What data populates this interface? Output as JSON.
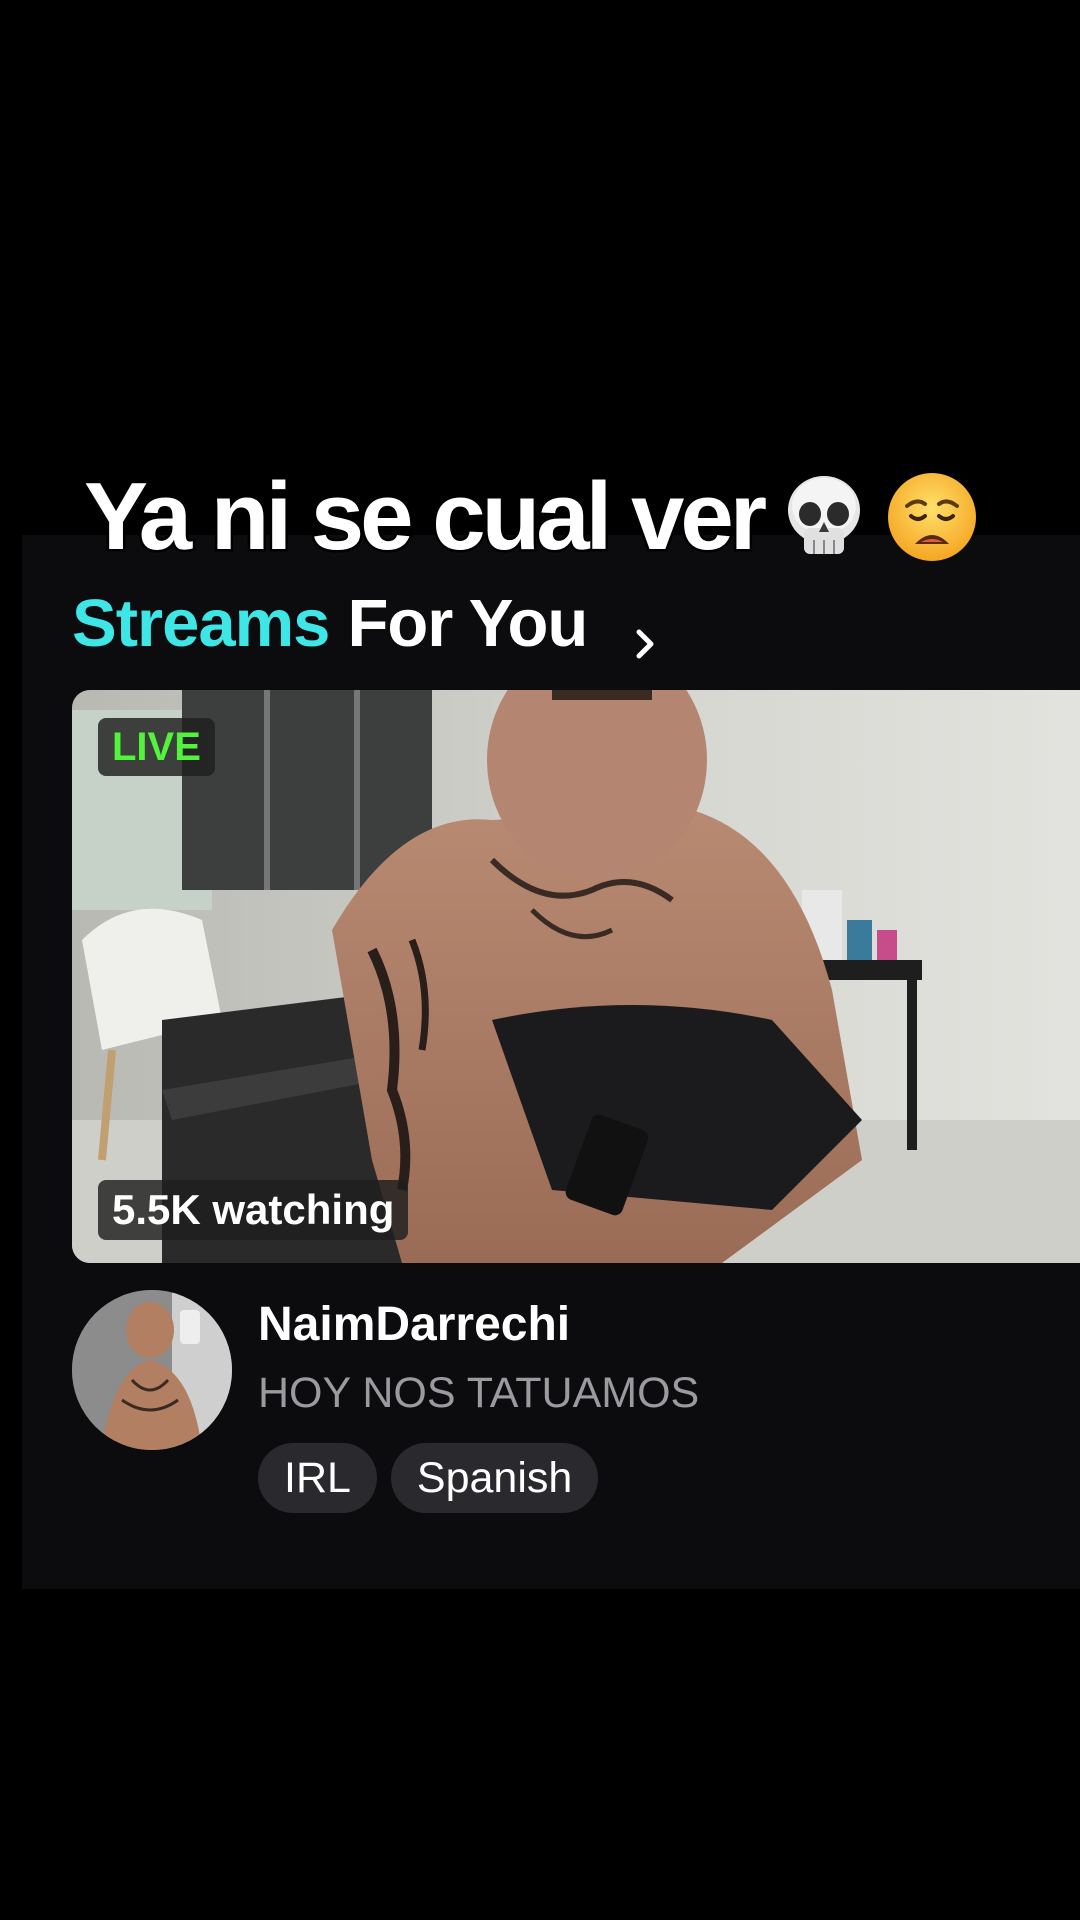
{
  "caption": {
    "text": "Ya ni se cual ver",
    "emojis": [
      "skull-emoji",
      "weary-face-emoji"
    ]
  },
  "section": {
    "title_accent": "Streams",
    "title_rest": "For You",
    "chevron_icon": "chevron-right-icon",
    "accent_color": "#3ee6e6"
  },
  "stream": {
    "live_label": "LIVE",
    "live_color": "#52f33b",
    "viewers_label": "5.5K watching",
    "streamer_name": "NaimDarrechi",
    "title": "HOY NOS TATUAMOS",
    "tags": [
      "IRL",
      "Spanish"
    ]
  }
}
